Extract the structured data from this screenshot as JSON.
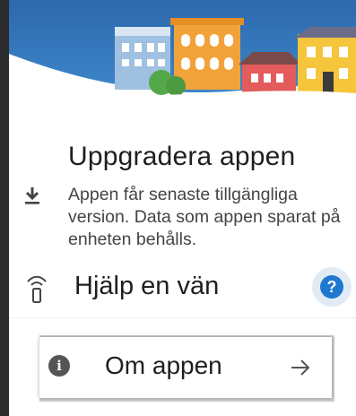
{
  "upgrade": {
    "title": "Uppgradera appen",
    "description": "Appen får senaste tillgängliga version. Data som appen sparat på enheten behålls.",
    "icon": "download-icon"
  },
  "help_friend": {
    "label": "Hjälp en vän",
    "icon": "wifi-signal-icon",
    "help_button_text": "?",
    "help_button_color": "#1e78d0"
  },
  "about": {
    "label": "Om appen",
    "icon": "info-icon",
    "info_glyph": "i",
    "arrow_icon": "arrow-right-icon"
  },
  "colors": {
    "accent": "#1e78d0",
    "banner_sky": "#2f6fb3"
  }
}
